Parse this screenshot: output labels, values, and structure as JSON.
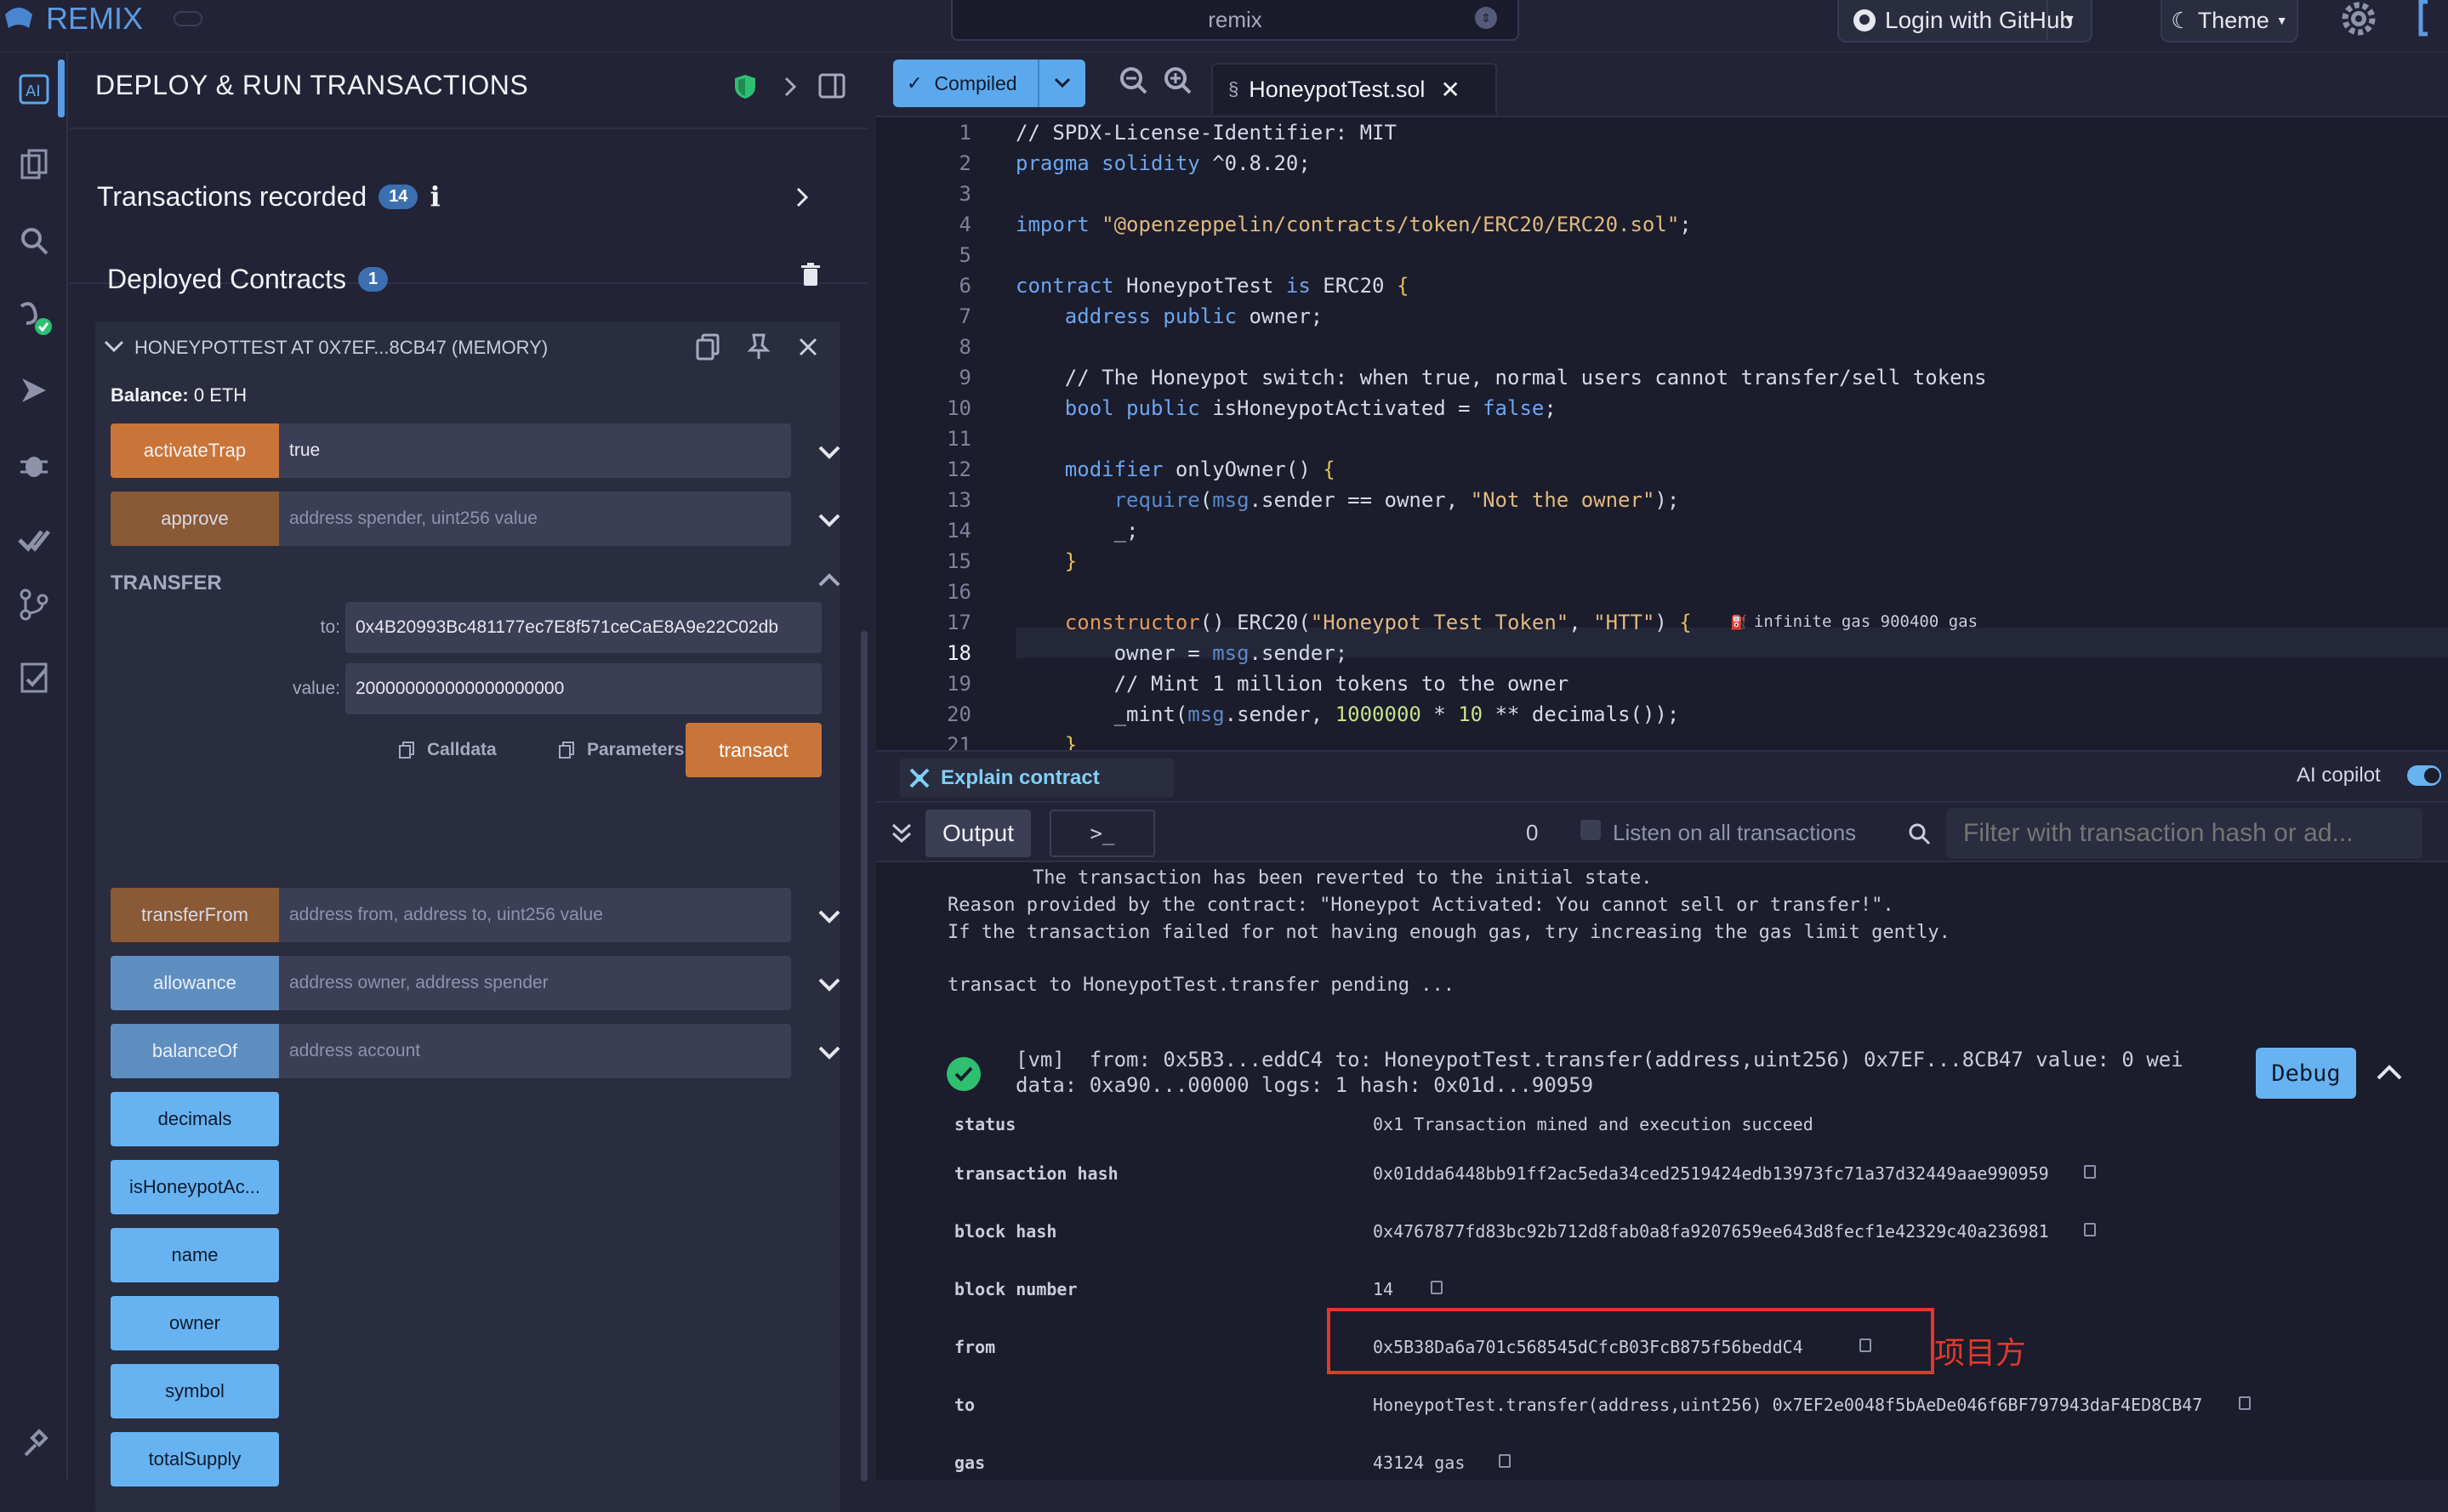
{
  "app": {
    "name": "REMIX",
    "workspace": "remix"
  },
  "topbar": {
    "login_label": "Login with GitHub",
    "theme_label": "Theme"
  },
  "panel": {
    "title": "DEPLOY & RUN TRANSACTIONS",
    "transactions_recorded": {
      "label": "Transactions recorded",
      "count": "14",
      "info": "i"
    },
    "deployed": {
      "label": "Deployed Contracts",
      "count": "1"
    },
    "contract": {
      "title": "HONEYPOTTEST AT 0X7EF...8CB47 (MEMORY)",
      "balance_label": "Balance:",
      "balance_value": "0 ETH",
      "functions": [
        {
          "name": "activateTrap",
          "input": "true"
        },
        {
          "name": "approve",
          "input": "address spender, uint256 value"
        }
      ],
      "transfer": {
        "header": "TRANSFER",
        "to_label": "to:",
        "to_value": "0x4B20993Bc481177ec7E8f571ceCaE8A9e22C02db",
        "value_label": "value:",
        "value_value": "200000000000000000000",
        "calldata_label": "Calldata",
        "parameters_label": "Parameters",
        "transact_label": "transact"
      },
      "functions2": [
        {
          "name": "transferFrom",
          "input": "address from, address to, uint256 value"
        },
        {
          "name": "allowance",
          "input": "address owner, address spender"
        },
        {
          "name": "balanceOf",
          "input": "address account"
        }
      ],
      "views": [
        "decimals",
        "isHoneypotAc...",
        "name",
        "owner",
        "symbol",
        "totalSupply"
      ]
    }
  },
  "editor": {
    "compiled_label": "Compiled",
    "file_tab": "HoneypotTest.sol",
    "gas_hint": "infinite gas 900400 gas",
    "lines": [
      "1",
      "2",
      "3",
      "4",
      "5",
      "6",
      "7",
      "8",
      "9",
      "10",
      "11",
      "12",
      "13",
      "14",
      "15",
      "16",
      "17",
      "18",
      "19",
      "20",
      "21"
    ]
  },
  "bottom": {
    "explain_label": "Explain contract",
    "ai_copilot_label": "AI copilot",
    "output_tab": "Output",
    "terminal_tab": ">_",
    "pending_count": "0",
    "listen_label": "Listen on all transactions",
    "filter_placeholder": "Filter with transaction hash or ad...",
    "log": {
      "reverted_line1": "The transaction has been reverted to the initial state.",
      "reverted_line2": "Reason provided by the contract: \"Honeypot Activated: You cannot sell or transfer!\".",
      "reverted_line3": "If the transaction failed for not having enough gas, try increasing the gas limit gently.",
      "pending": "transact to HoneypotTest.transfer pending ...",
      "vm_line1": "[vm]  from: 0x5B3...eddC4 to: HoneypotTest.transfer(address,uint256) 0x7EF...8CB47 value: 0 wei",
      "vm_line2": "data: 0xa90...00000 logs: 1 hash: 0x01d...90959",
      "debug_label": "Debug"
    },
    "receipt": [
      {
        "key": "status",
        "value": "0x1 Transaction mined and execution succeed",
        "copy": false
      },
      {
        "key": "transaction hash",
        "value": "0x01dda6448bb91ff2ac5eda34ced2519424edb13973fc71a37d32449aae990959",
        "copy": true
      },
      {
        "key": "block hash",
        "value": "0x4767877fd83bc92b712d8fab0a8fa9207659ee643d8fecf1e42329c40a236981",
        "copy": true
      },
      {
        "key": "block number",
        "value": "14",
        "copy": true
      },
      {
        "key": "from",
        "value": "0x5B38Da6a701c568545dCfcB03FcB875f56beddC4",
        "copy": true
      },
      {
        "key": "to",
        "value": "HoneypotTest.transfer(address,uint256) 0x7EF2e0048f5bAeDe046f6BF797943daF4ED8CB47",
        "copy": true
      },
      {
        "key": "gas",
        "value": "43124 gas",
        "copy": true
      }
    ],
    "annotation": "项目方"
  },
  "colors": {
    "accent": "#5b9be3",
    "transact": "#c97539",
    "call": "#67b3f2",
    "highlight_box": "#e2382c"
  }
}
